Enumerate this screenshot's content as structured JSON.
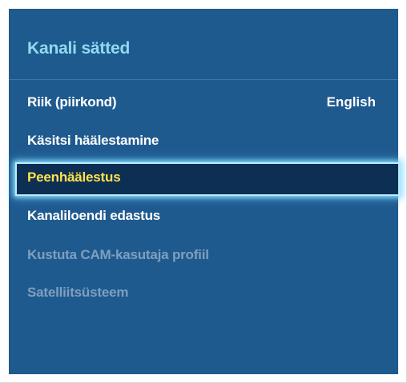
{
  "panel": {
    "title": "Kanali sätted",
    "items": [
      {
        "label": "Riik (piirkond)",
        "value": "English",
        "state": "enabled"
      },
      {
        "label": "Käsitsi häälestamine",
        "state": "enabled"
      },
      {
        "label": "Peenhäälestus",
        "state": "selected"
      },
      {
        "label": "Kanaliloendi edastus",
        "state": "enabled"
      },
      {
        "label": "Kustuta CAM-kasutaja profiil",
        "state": "disabled"
      },
      {
        "label": "Satelliitsüsteem",
        "state": "disabled"
      }
    ]
  },
  "colors": {
    "panel_background": "#1f5a8f",
    "title_text": "#8fdcef",
    "item_text": "#ffffff",
    "selected_text": "#ffe24a",
    "selected_background": "#0d2f54",
    "selected_glow": "#b9ecff",
    "disabled_text": "#7f9fbe"
  }
}
